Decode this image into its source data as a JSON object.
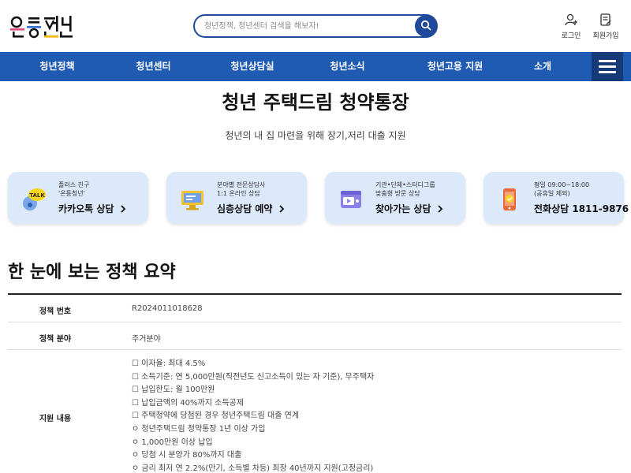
{
  "header": {
    "logo_text": "온통청년",
    "search_placeholder": "청년정책, 청년센터 검색을 해보자!",
    "login_label": "로그인",
    "signup_label": "회원가입"
  },
  "nav": {
    "items": [
      "청년정책",
      "청년센터",
      "청년상담실",
      "청년소식",
      "청년고용 지원",
      "소개"
    ]
  },
  "page": {
    "title": "청년 주택드림 청약통장",
    "subtitle": "청년의 내 집 마련을 위해 장기,저리 대출 지원"
  },
  "cards": [
    {
      "small1": "플러스 친구",
      "small2": "'온통청년'",
      "big": "카카오톡 상담",
      "icon": "kakaotalk-icon"
    },
    {
      "small1": "분야별 전문상담사",
      "small2": "1:1 온라인 상담",
      "big": "심층상담 예약",
      "icon": "online-consult-icon"
    },
    {
      "small1": "기관•단체•스터디그룹",
      "small2": "맞춤형 방문 상담",
      "big": "찾아가는 상담",
      "icon": "visit-consult-icon"
    },
    {
      "small1": "평일 09:00~18:00",
      "small2": "(공휴일 제외)",
      "big": "전화상담 1811-9876",
      "icon": "phone-icon"
    }
  ],
  "summary": {
    "title": "한 눈에 보는 정책 요약",
    "rows": [
      {
        "label": "정책 번호",
        "value": "R2024011018628"
      },
      {
        "label": "정책 분야",
        "value": "주거분야"
      },
      {
        "label": "지원 내용",
        "items": [
          "☐ 이자율: 최대 4.5%",
          "☐ 소득기준: 연 5,000만원(직전년도 신고소득이 있는 자 기준), 무주택자",
          "☐ 납입한도: 월 100만원",
          "☐ 납입금액의 40%까지 소득공제",
          "☐ 주택청약에 당첨된 경우 청년주택드림 대출 연계",
          "ㅇ 청년주택드림 청약통장 1년 이상 가입",
          "ㅇ 1,000만원 이상 납입",
          "ㅇ 당첨 시 분양가 80%까지 대출",
          "ㅇ 금리 최저 연 2.2%(만기, 소득별 차등) 최장 40년까지 지원(고정금리)"
        ]
      }
    ]
  },
  "colors": {
    "nav_blue": "#1f5bb3",
    "menu_dark": "#163a78",
    "card_bg": "#dbe9fb",
    "search_border": "#1f4a9c"
  }
}
